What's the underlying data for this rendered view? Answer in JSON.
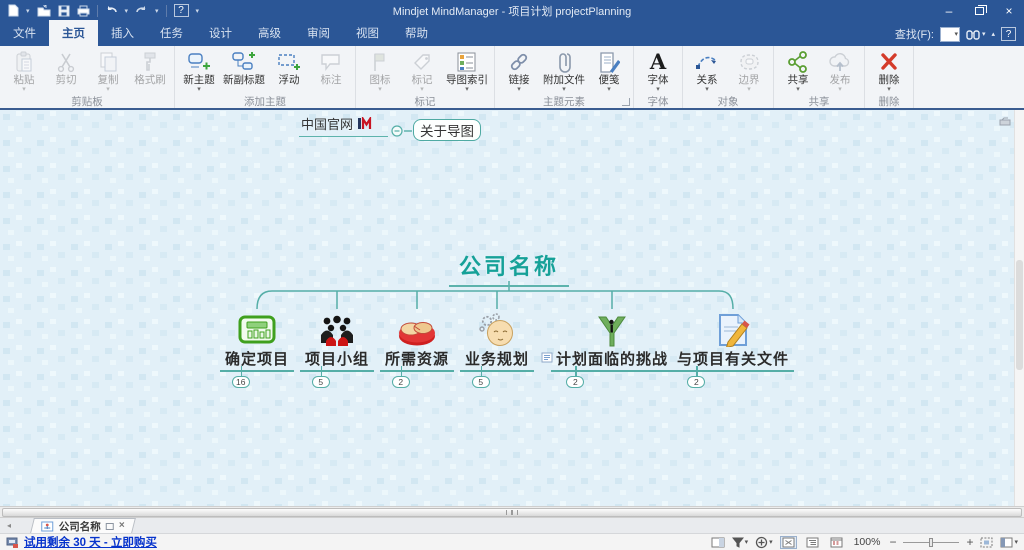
{
  "window": {
    "title": "Mindjet MindManager - 项目计划 projectPlanning"
  },
  "tabs": [
    "文件",
    "主页",
    "插入",
    "任务",
    "设计",
    "高级",
    "审阅",
    "视图",
    "帮助"
  ],
  "search": {
    "label": "查找(F):"
  },
  "glyphs": {
    "caret": "▾",
    "caret_up": "▴",
    "help": "?",
    "minimize": "–",
    "close": "×",
    "nav_left": "◂",
    "zoom_out": "−",
    "zoom_in": "+",
    "font_icon": "A"
  },
  "ribbon": {
    "groups": [
      {
        "label": "剪贴板",
        "buttons": [
          {
            "label": "粘贴"
          },
          {
            "label": "剪切"
          },
          {
            "label": "复制"
          },
          {
            "label": "格式刷"
          }
        ]
      },
      {
        "label": "添加主题",
        "buttons": [
          {
            "label": "新主题"
          },
          {
            "label": "新副标题"
          },
          {
            "label": "浮动"
          },
          {
            "label": "标注"
          }
        ]
      },
      {
        "label": "标记",
        "buttons": [
          {
            "label": "图标"
          },
          {
            "label": "标记"
          },
          {
            "label": "导图索引"
          }
        ]
      },
      {
        "label": "主题元素",
        "buttons": [
          {
            "label": "链接"
          },
          {
            "label": "附加文件"
          },
          {
            "label": "便笺"
          }
        ]
      },
      {
        "label": "字体",
        "buttons": [
          {
            "label": "字体"
          }
        ]
      },
      {
        "label": "对象",
        "buttons": [
          {
            "label": "关系"
          },
          {
            "label": "边界"
          }
        ]
      },
      {
        "label": "共享",
        "buttons": [
          {
            "label": "共享"
          },
          {
            "label": "发布"
          }
        ]
      },
      {
        "label": "删除",
        "buttons": [
          {
            "label": "删除"
          }
        ]
      }
    ]
  },
  "map": {
    "central_topic": "公司名称",
    "floating_topic": "中国官网",
    "callout_topic": "关于导图",
    "children": [
      {
        "label": "确定项目",
        "count": "16"
      },
      {
        "label": "项目小组",
        "count": "5"
      },
      {
        "label": "所需资源",
        "count": "2"
      },
      {
        "label": "业务规划",
        "count": "5"
      },
      {
        "label": "计划面临的挑战",
        "count": "2"
      },
      {
        "label": "与项目有关文件",
        "count": "2"
      }
    ]
  },
  "tab_bar": {
    "map_tab": "公司名称"
  },
  "status_bar": {
    "trial_text": "试用剩余 30 天 - 立即购买",
    "zoom_level": "100%"
  },
  "colors": {
    "titlebar": "#2b5696",
    "topic_teal": "#16a198",
    "line_teal": "#55aea7",
    "canvas": "#e2f0f8"
  }
}
